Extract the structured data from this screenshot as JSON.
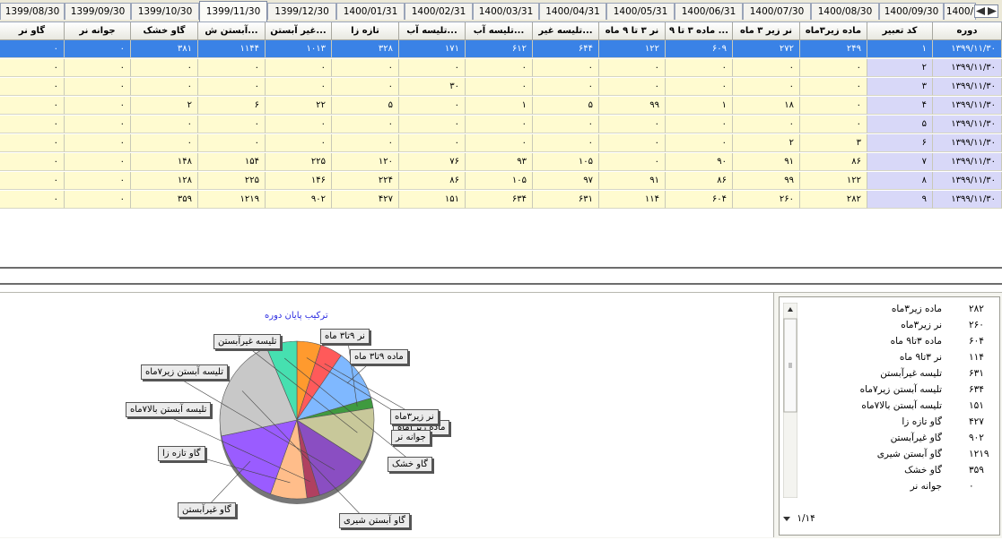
{
  "tabs": [
    "1399/08/30",
    "1399/09/30",
    "1399/10/30",
    "1399/11/30",
    "1399/12/30",
    "1400/01/31",
    "1400/02/31",
    "1400/03/31",
    "1400/04/31",
    "1400/05/31",
    "1400/06/31",
    "1400/07/30",
    "1400/08/30",
    "1400/09/30",
    "1400/"
  ],
  "active_tab_index": 3,
  "grid": {
    "headers": [
      "دوره",
      "کد تعبیر",
      "ماده زیر۳ماه",
      "نر زیر ۳ ماه",
      "ماده ۳ تا ۹ ...",
      "نر ۳ تا ۹ ماه",
      "تلیسه غیر...",
      "تلیسه آب...",
      "تلیسه آب...",
      "تازه زا",
      "غیر آبستن...",
      "آبستن ش...",
      "گاو خشک",
      "جوانه نر",
      "گاو نر"
    ],
    "rows": [
      [
        "۱۳۹۹/۱۱/۳۰",
        "۱",
        "۲۴۹",
        "۲۷۲",
        "۶۰۹",
        "۱۲۲",
        "۶۴۴",
        "۶۱۲",
        "۱۷۱",
        "۳۲۸",
        "۱۰۱۳",
        "۱۱۴۴",
        "۳۸۱",
        "۰",
        "۰"
      ],
      [
        "۱۳۹۹/۱۱/۳۰",
        "۲",
        "۰",
        "۰",
        "۰",
        "۰",
        "۰",
        "۰",
        "۰",
        "۰",
        "۰",
        "۰",
        "۰",
        "۰",
        "۰"
      ],
      [
        "۱۳۹۹/۱۱/۳۰",
        "۳",
        "۰",
        "۰",
        "۰",
        "۰",
        "۰",
        "۰",
        "۳۰",
        "۰",
        "۰",
        "۰",
        "۰",
        "۰",
        "۰"
      ],
      [
        "۱۳۹۹/۱۱/۳۰",
        "۴",
        "۰",
        "۱۸",
        "۱",
        "۹۹",
        "۵",
        "۱",
        "۰",
        "۵",
        "۲۲",
        "۶",
        "۲",
        "۰",
        "۰"
      ],
      [
        "۱۳۹۹/۱۱/۳۰",
        "۵",
        "۰",
        "۰",
        "۰",
        "۰",
        "۰",
        "۰",
        "۰",
        "۰",
        "۰",
        "۰",
        "۰",
        "۰",
        "۰"
      ],
      [
        "۱۳۹۹/۱۱/۳۰",
        "۶",
        "۳",
        "۲",
        "۰",
        "۰",
        "۰",
        "۰",
        "۰",
        "۰",
        "۰",
        "۰",
        "۰",
        "۰",
        "۰"
      ],
      [
        "۱۳۹۹/۱۱/۳۰",
        "۷",
        "۸۶",
        "۹۱",
        "۹۰",
        "۰",
        "۱۰۵",
        "۹۳",
        "۷۶",
        "۱۲۰",
        "۲۲۵",
        "۱۵۴",
        "۱۴۸",
        "۰",
        "۰"
      ],
      [
        "۱۳۹۹/۱۱/۳۰",
        "۸",
        "۱۲۲",
        "۹۹",
        "۸۶",
        "۹۱",
        "۹۷",
        "۱۰۵",
        "۸۶",
        "۲۲۴",
        "۱۴۶",
        "۲۲۵",
        "۱۲۸",
        "۰",
        "۰"
      ],
      [
        "۱۳۹۹/۱۱/۳۰",
        "۹",
        "۲۸۲",
        "۲۶۰",
        "۶۰۴",
        "۱۱۴",
        "۶۳۱",
        "۶۳۴",
        "۱۵۱",
        "۴۲۷",
        "۹۰۲",
        "۱۲۱۹",
        "۳۵۹",
        "۰",
        "۰"
      ]
    ],
    "selected_row_index": 0
  },
  "chart_data": {
    "type": "pie",
    "title": "ترکیب پایان دوره",
    "categories": [
      "ماده زیر۳ماه",
      "نر زیر۳ماه",
      "ماده ۳تا۹ ماه",
      "نر ۳تا۹ ماه",
      "تلیسه غیرآبستن",
      "تلیسه آبستن زیر۷ماه",
      "تلیسه آبستن بالا۷ماه",
      "گاو تازه زا",
      "گاو غیرآبستن",
      "گاو آبستن شیری",
      "گاو خشک",
      "جوانه نر"
    ],
    "values": [
      282,
      260,
      604,
      114,
      631,
      634,
      151,
      427,
      902,
      1219,
      359,
      0
    ],
    "colors": [
      "#ff9a2e",
      "#ff5a5a",
      "#7fb8ff",
      "#3f9a3f",
      "#c8c89a",
      "#8a4ec2",
      "#b04060",
      "#ffbd8a",
      "#9a5cff",
      "#c8c8c8",
      "#46e0b0",
      "#2a8aff"
    ],
    "slice_labels": [
      "ماده زیر۳ماه",
      "نر زیر۳ماه",
      "ماده ۹تا۳ ماه",
      "نر ۹تا۳ ماه",
      "تلیسه غیرآبستن",
      "تلیسه آبستن زیر۷ماه",
      "تلیسه آبستن بالا۷ماه",
      "گاو تازه زا",
      "گاو غیرآبستن",
      "گاو آبستن شیری",
      "گاو خشک",
      "جوانه نر"
    ]
  },
  "legend": {
    "items": [
      {
        "name": "ماده زیر۳ماه",
        "value": "۲۸۲"
      },
      {
        "name": "نر زیر۳ماه",
        "value": "۲۶۰"
      },
      {
        "name": "ماده ۳تا۹ ماه",
        "value": "۶۰۴"
      },
      {
        "name": "نر ۳تا۹ ماه",
        "value": "۱۱۴"
      },
      {
        "name": "تلیسه غیرآبستن",
        "value": "۶۳۱"
      },
      {
        "name": "تلیسه آبستن زیر۷ماه",
        "value": "۶۳۴"
      },
      {
        "name": "تلیسه آبستن بالا۷ماه",
        "value": "۱۵۱"
      },
      {
        "name": "گاو تازه زا",
        "value": "۴۲۷"
      },
      {
        "name": "گاو غیرآبستن",
        "value": "۹۰۲"
      },
      {
        "name": "گاو آبستن شیری",
        "value": "۱۲۱۹"
      },
      {
        "name": "گاو خشک",
        "value": "۳۵۹"
      },
      {
        "name": "جوانه نر",
        "value": "۰"
      }
    ],
    "page_indicator": "۱/۱۴"
  }
}
